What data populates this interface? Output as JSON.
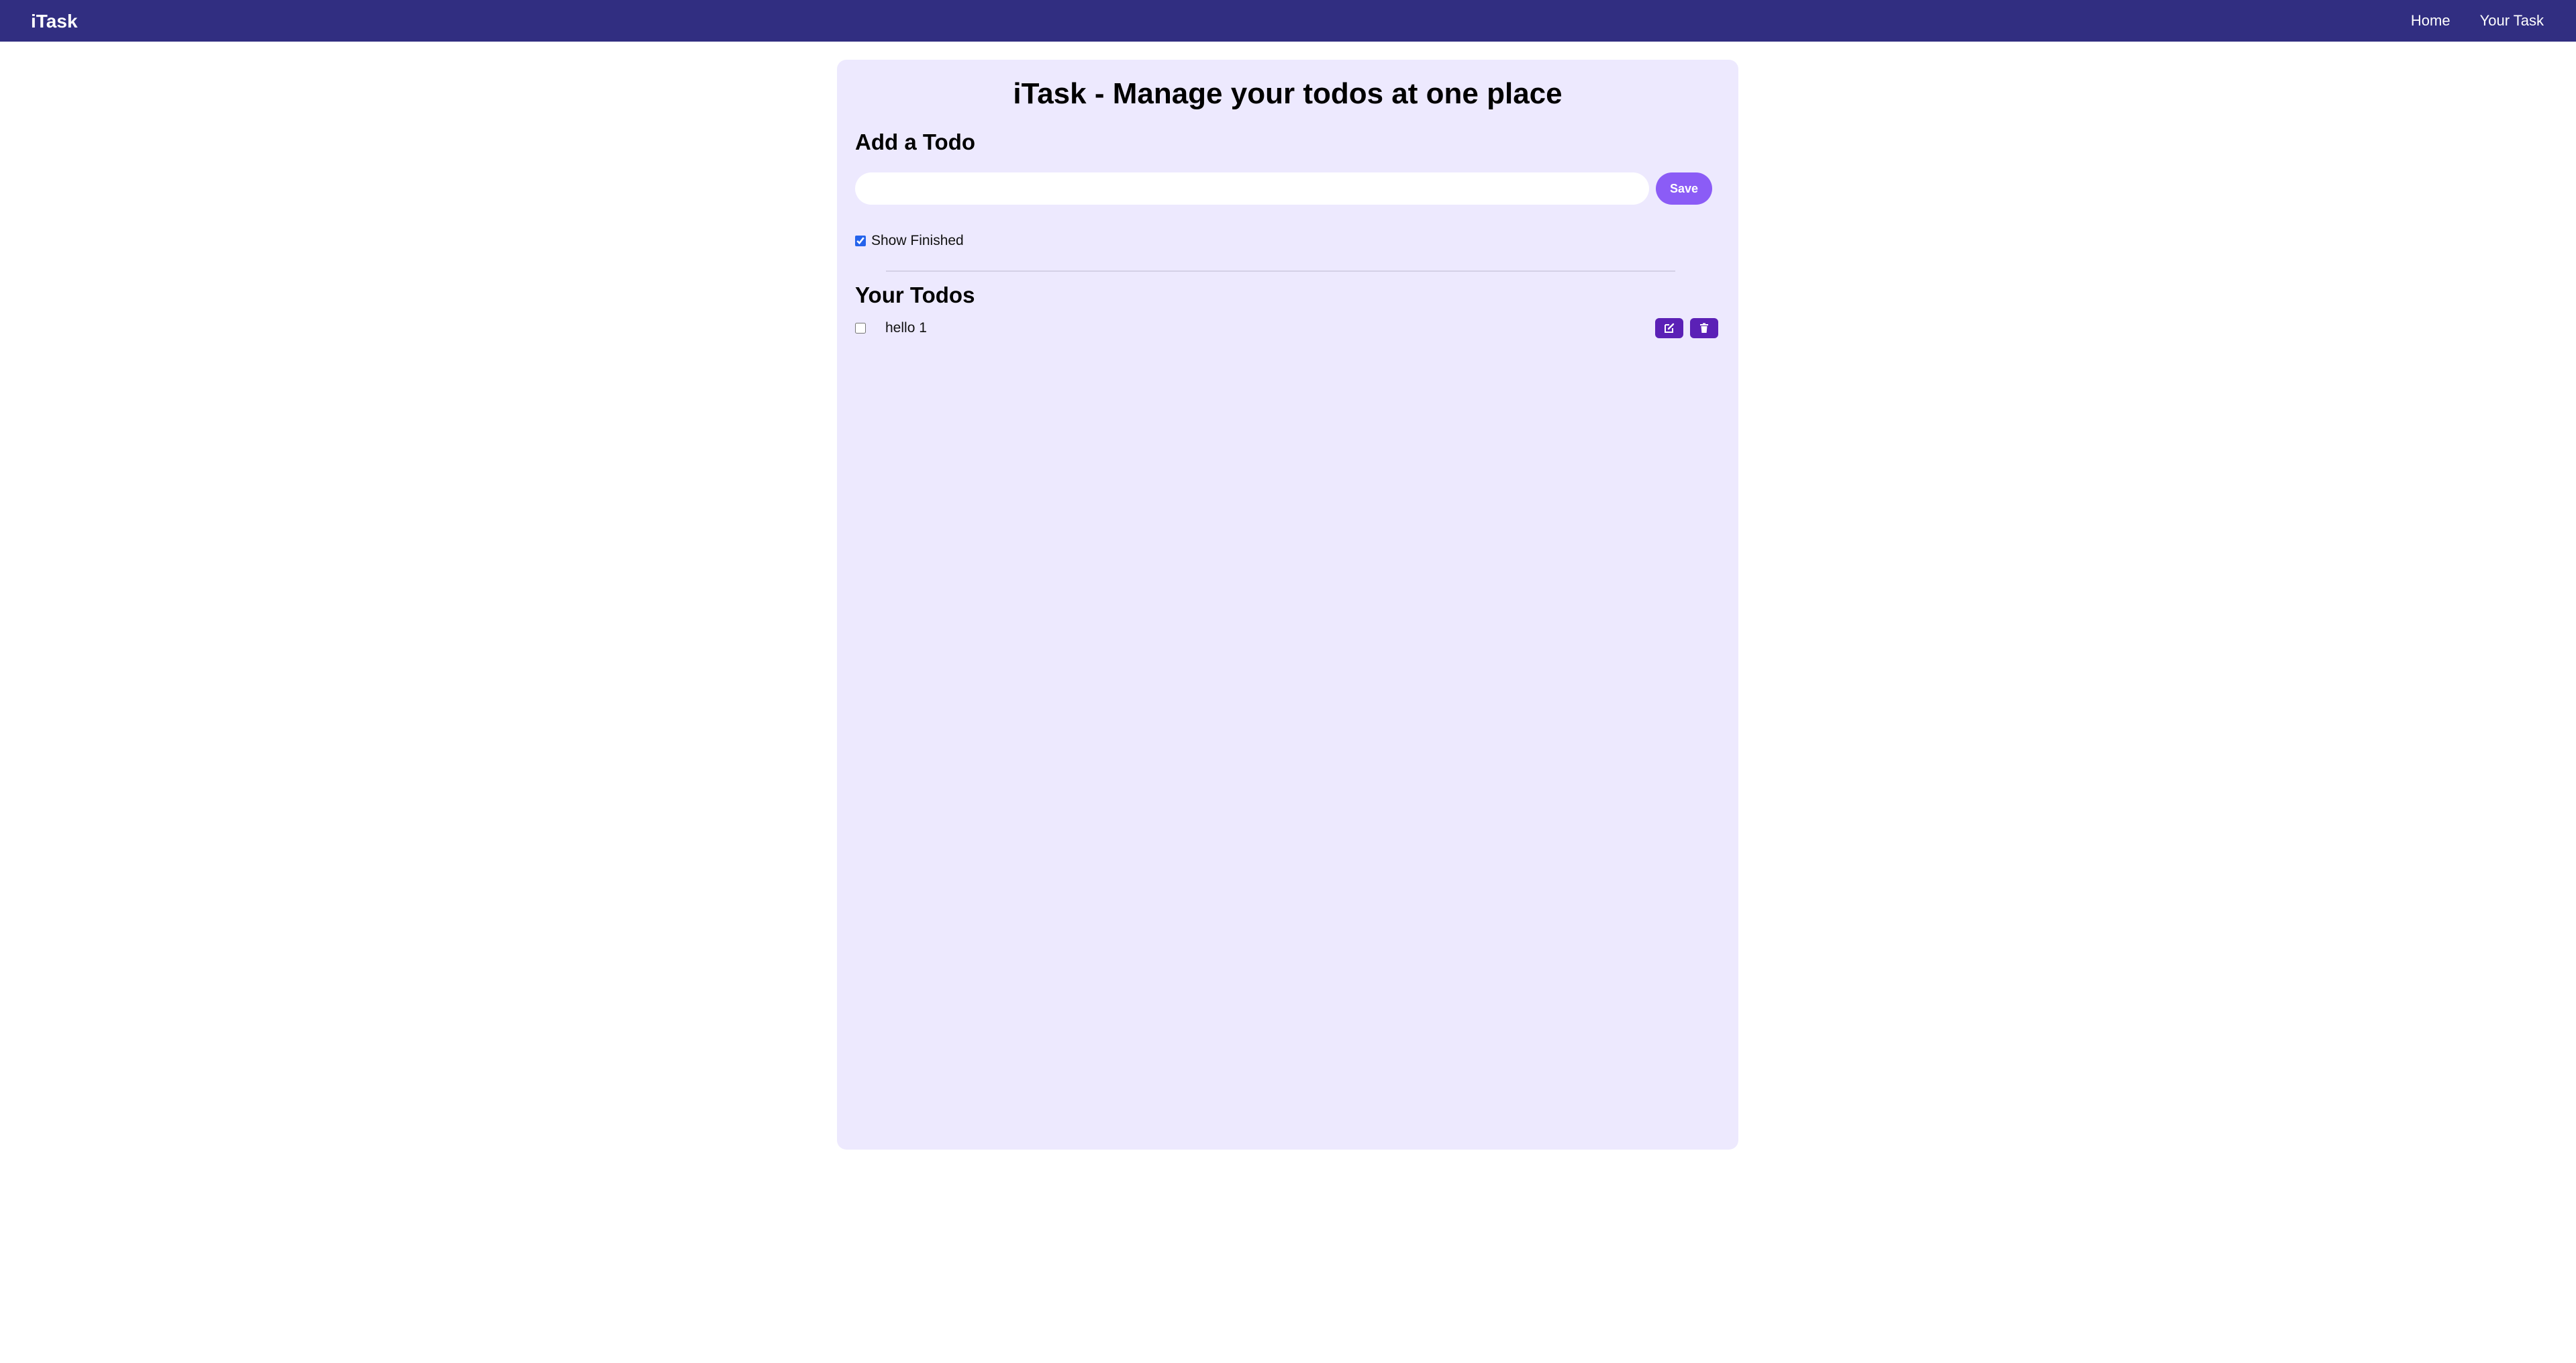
{
  "navbar": {
    "brand": "iTask",
    "links": [
      "Home",
      "Your Task"
    ]
  },
  "main": {
    "title": "iTask - Manage your todos at one place",
    "add_section": {
      "title": "Add a Todo",
      "input_value": "",
      "input_placeholder": "",
      "save_label": "Save"
    },
    "show_finished": {
      "label": "Show Finished",
      "checked": true
    },
    "todos_section": {
      "title": "Your Todos",
      "items": [
        {
          "text": "hello 1",
          "completed": false,
          "edit_icon": "edit-icon",
          "delete_icon": "trash-icon"
        }
      ]
    }
  },
  "colors": {
    "navbar_bg": "#312e81",
    "card_bg": "#ede9fe",
    "save_button": "#8b5cf6",
    "action_button": "#5b21b6"
  }
}
